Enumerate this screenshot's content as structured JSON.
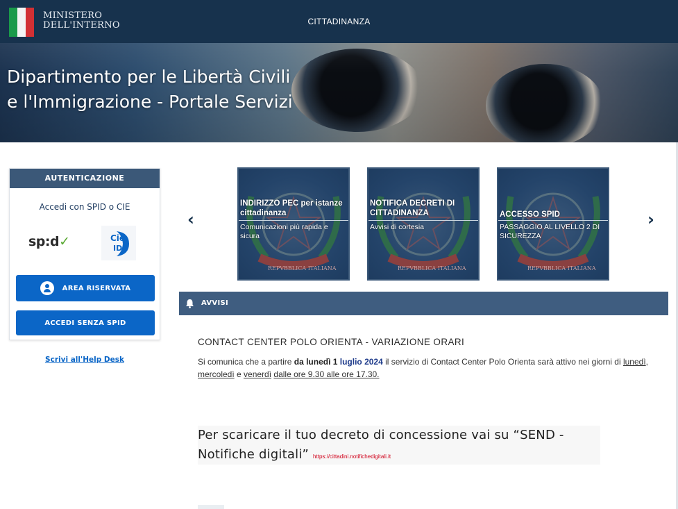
{
  "header": {
    "ministero_line1": "MINISTERO",
    "ministero_line2": "DELL'INTERNO",
    "center_label": "CITTADINANZA"
  },
  "hero": {
    "title_line1": "Dipartimento per le Libertà Civili",
    "title_line2": "e l'Immigrazione - Portale Servizi"
  },
  "auth": {
    "heading": "AUTENTICAZIONE",
    "subtitle": "Accedi con SPID o CIE",
    "spid_logo_text": "sp:d",
    "cie_logo_text": "Cie ID",
    "area_riservata_label": "AREA RISERVATA",
    "accedi_senza_spid_label": "ACCEDI SENZA SPID",
    "helpdesk_link": "Scrivi all'Help Desk"
  },
  "carousel": {
    "prev_icon": "chevron-left-icon",
    "next_icon": "chevron-right-icon",
    "cards": [
      {
        "title": "INDIRIZZO PEC per istanze cittadinanza",
        "description": "Comunicazioni più rapida e sicura"
      },
      {
        "title": "NOTIFICA DECRETI DI CITTADINANZA",
        "description": "Avvisi di cortesia"
      },
      {
        "title": "ACCESSO SPID",
        "description": "PASSAGGIO AL LIVELLO 2 DI SICUREZZA"
      }
    ],
    "emblem_text": "REPVBBLICA ITALIANA"
  },
  "avvisi": {
    "label": "AVVISI",
    "icon": "bell-icon"
  },
  "notice": {
    "title": "CONTACT CENTER POLO ORIENTA - VARIAZIONE ORARI",
    "body_part1": "Si comunica che a partire ",
    "body_bold1": "da lunedì 1 ",
    "body_blue": "luglio 2024",
    "body_part2": " il servizio di Contact Center Polo Orienta sarà attivo nei giorni di ",
    "day1": "lunedì",
    "sep1": ", ",
    "day2": "mercoledì",
    "sep2": " e ",
    "day3": "venerdì",
    "sep3": " ",
    "hours": "dalle ore 9.30 alle ore 17.30."
  },
  "send": {
    "title": "Per scaricare il tuo decreto di concessione vai su “SEND - Notifiche digitali”",
    "link": "https://cittadini.notifichedigitali.it"
  },
  "colors": {
    "header_bg": "#17324d",
    "primary_button": "#0b66c7",
    "avvisi_bar": "#3f5d80",
    "auth_head": "#3b5878",
    "link_red": "#d0021b"
  }
}
